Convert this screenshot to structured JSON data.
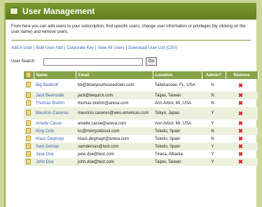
{
  "header": {
    "title": "User Management"
  },
  "intro": "From here you can add users to your subscription, find specific users, change user information or privileges (by clicking on the user name) and remove users.",
  "links": [
    {
      "label": "Add A User"
    },
    {
      "label": "Bulk User Add"
    },
    {
      "label": "Corporate Key"
    },
    {
      "label": "View All Users"
    },
    {
      "label": "Download User List (CSV)"
    }
  ],
  "search": {
    "label": "User Search:",
    "value": "",
    "go_label": "Go"
  },
  "table": {
    "headers": [
      "Name",
      "Email",
      "Location",
      "Admin?",
      "Remove"
    ],
    "rows": [
      {
        "name": "Big Badwolf",
        "email": "bb@blowyourhousedown.com",
        "location": "Tallahassee, FL, USA",
        "admin": "N"
      },
      {
        "name": "Jack Beanstalk",
        "email": "jack@bequick.com",
        "location": "Taipei, Taiwan",
        "admin": "N"
      },
      {
        "name": "Thomas Brehm",
        "email": "thomas.brehm@areva.com",
        "location": "Ann Arbor, MI, USA",
        "admin": "N"
      },
      {
        "name": "Mauricio Caceres",
        "email": "mauricio.caceres@wes-americas.com",
        "location": "Tokyo, Japan",
        "admin": "Y"
      },
      {
        "name": "Amelie Casse",
        "email": "amelie.casse@areva.com",
        "location": "Ann Arbor, MI, USA",
        "admin": "Y"
      },
      {
        "name": "King Cole",
        "email": "kc@merryoldsoul.com",
        "location": "Toledo, Spain",
        "admin": "N"
      },
      {
        "name": "Klaus Degmayr",
        "email": "klaus.degmayr@areva.com",
        "location": "Toledo, Spain",
        "admin": "N"
      },
      {
        "name": "Sam Deman",
        "email": "samdeman@test.com",
        "location": "Toledo, Spain",
        "admin": "Y"
      },
      {
        "name": "Jane Doe",
        "email": "jane.doe@test.com",
        "location": "Tirana, Albania",
        "admin": "Y"
      },
      {
        "name": "John Doe",
        "email": "john.doe@test.com",
        "location": "Taipei, Taiwan",
        "admin": "Y"
      }
    ]
  },
  "icons": {
    "row_icon": "document-icon",
    "remove_icon": "red-x-icon"
  },
  "colors": {
    "header_bg": "#6b8a25",
    "table_header_bg": "#86a349",
    "link": "#3a64b5",
    "remove": "#cc2222"
  }
}
